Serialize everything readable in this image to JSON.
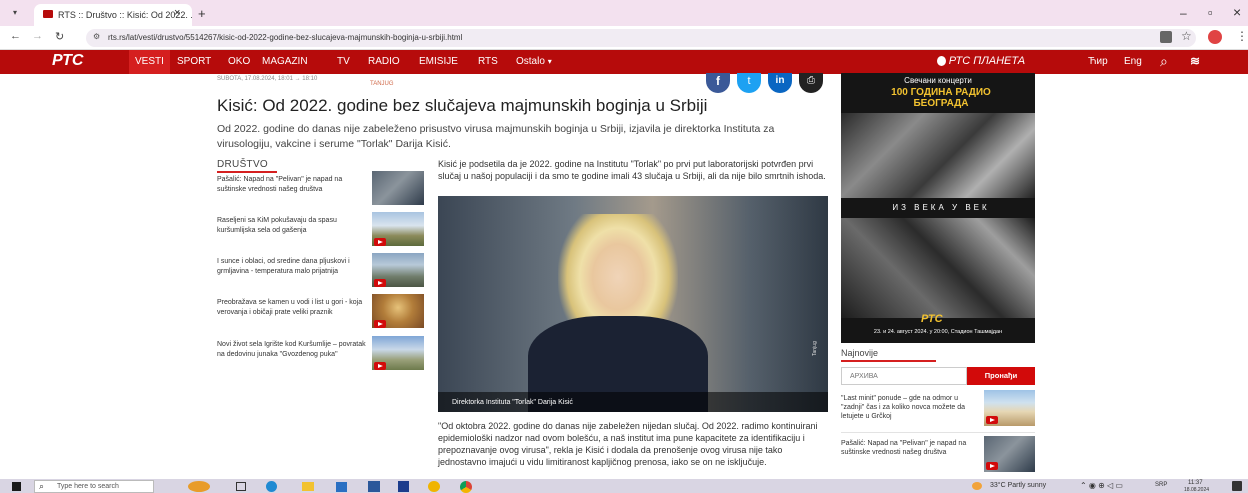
{
  "browser": {
    "tab_title": "RTS :: Društvo :: Kisić: Od 2022. ...",
    "url": "rts.rs/lat/vesti/drustvo/5514267/kisic-od-2022-godine-bez-slucajeva-majmunskih-boginja-u-srbiji.html",
    "add_tab": "+",
    "close_tab": "×",
    "minimize": "–",
    "restore": "▫",
    "close": "×"
  },
  "site_nav": {
    "logo": "РТС",
    "items": [
      "VESTI",
      "SPORT",
      "OKO",
      "MAGAZIN",
      "TV",
      "RADIO",
      "EMISIJE",
      "RTS",
      "Ostalo"
    ],
    "planeta": "РТС ПЛАНЕТА",
    "lang_cyr": "Ћир",
    "lang_eng": "Eng",
    "accent": "#b60b0b"
  },
  "article": {
    "date": "SUBOTA, 17.08.2024, 18:01 → 18:10",
    "source": "TANJUG",
    "title": "Kisić: Od 2022. godine bez slučajeva majmunskih boginja u Srbiji",
    "lead": "Od 2022. godine do danas nije zabeleženo prisustvo virusa majmunskih boginja u Srbiji, izjavila je direktorka Instituta za virusologiju, vakcine i serume \"Torlak\" Darija Kisić.",
    "paragraph1": "Kisić je podsetila da je 2022. godine na Institutu \"Torlak\" po prvi put laboratorijski potvrđen prvi slučaj u našoj populaciji i da smo te godine imali 43 slučaja u Srbiji, ali da nije bilo smrtnih ishoda.",
    "photo_caption": "Direktorka Instituta \"Torlak\" Darija Kisić",
    "photo_credit": "Tanjug",
    "paragraph2": "\"Od oktobra 2022. godine do danas nije zabeležen nijedan slučaj. Od 2022. radimo kontinuirani epidemiološki nadzor nad ovom bolešću, a naš institut ima pune kapacitete za identifikaciju i prepoznavanje ovog virusa\", rekla je Kisić i dodala da prenošenje ovog virusa nije tako jednostavno imajući u vidu limitiranost kapljičnog prenosa, iako se on ne isključuje."
  },
  "sidebar": {
    "heading": "DRUŠTVO",
    "items": [
      {
        "text": "Pašalić: Napad na \"Pelivan\" je napad na suštinske vrednosti našeg društva",
        "video": false
      },
      {
        "text": "Raseljeni sa KiM pokušavaju da spasu kuršumlijska sela od gašenja",
        "video": true
      },
      {
        "text": "I sunce i oblaci, od sredine dana pljuskovi i grmljavina - temperatura malo prijatnija",
        "video": true
      },
      {
        "text": "Preobražava se kamen u vodi i list u gori - koja verovanja i običaji prate veliki praznik",
        "video": true
      },
      {
        "text": "Novi život sela Igrište kod Kuršumlije – povratak na dedovinu junaka \"Gvozdenog puka\"",
        "video": true
      }
    ]
  },
  "promo": {
    "top_line": "Свечани концерти",
    "headline": "100 ГОДИНА РАДИО БЕОГРАДА",
    "middle": "ИЗ ВЕКА У ВЕК",
    "logo": "РТС",
    "footer": "23. и 24. август 2024. у 20:00, Стадион Ташмајдан"
  },
  "right_col": {
    "heading": "Najnovije",
    "archive_placeholder": "АРХИВА",
    "search_button": "Пронађи",
    "items": [
      {
        "text": "\"Last minit\" ponude – gde na odmor u \"zadnji\" čas i za koliko novca možete da letujete u Grčkoj"
      },
      {
        "text": "Pašalić: Napad na \"Pelivan\" je napad na suštinske vrednosti našeg društva"
      }
    ]
  },
  "taskbar": {
    "search_placeholder": "Type here to search",
    "weather": "33°C  Partly sunny",
    "lang": "SRP",
    "time": "11:37",
    "date": "18.08.2024"
  }
}
